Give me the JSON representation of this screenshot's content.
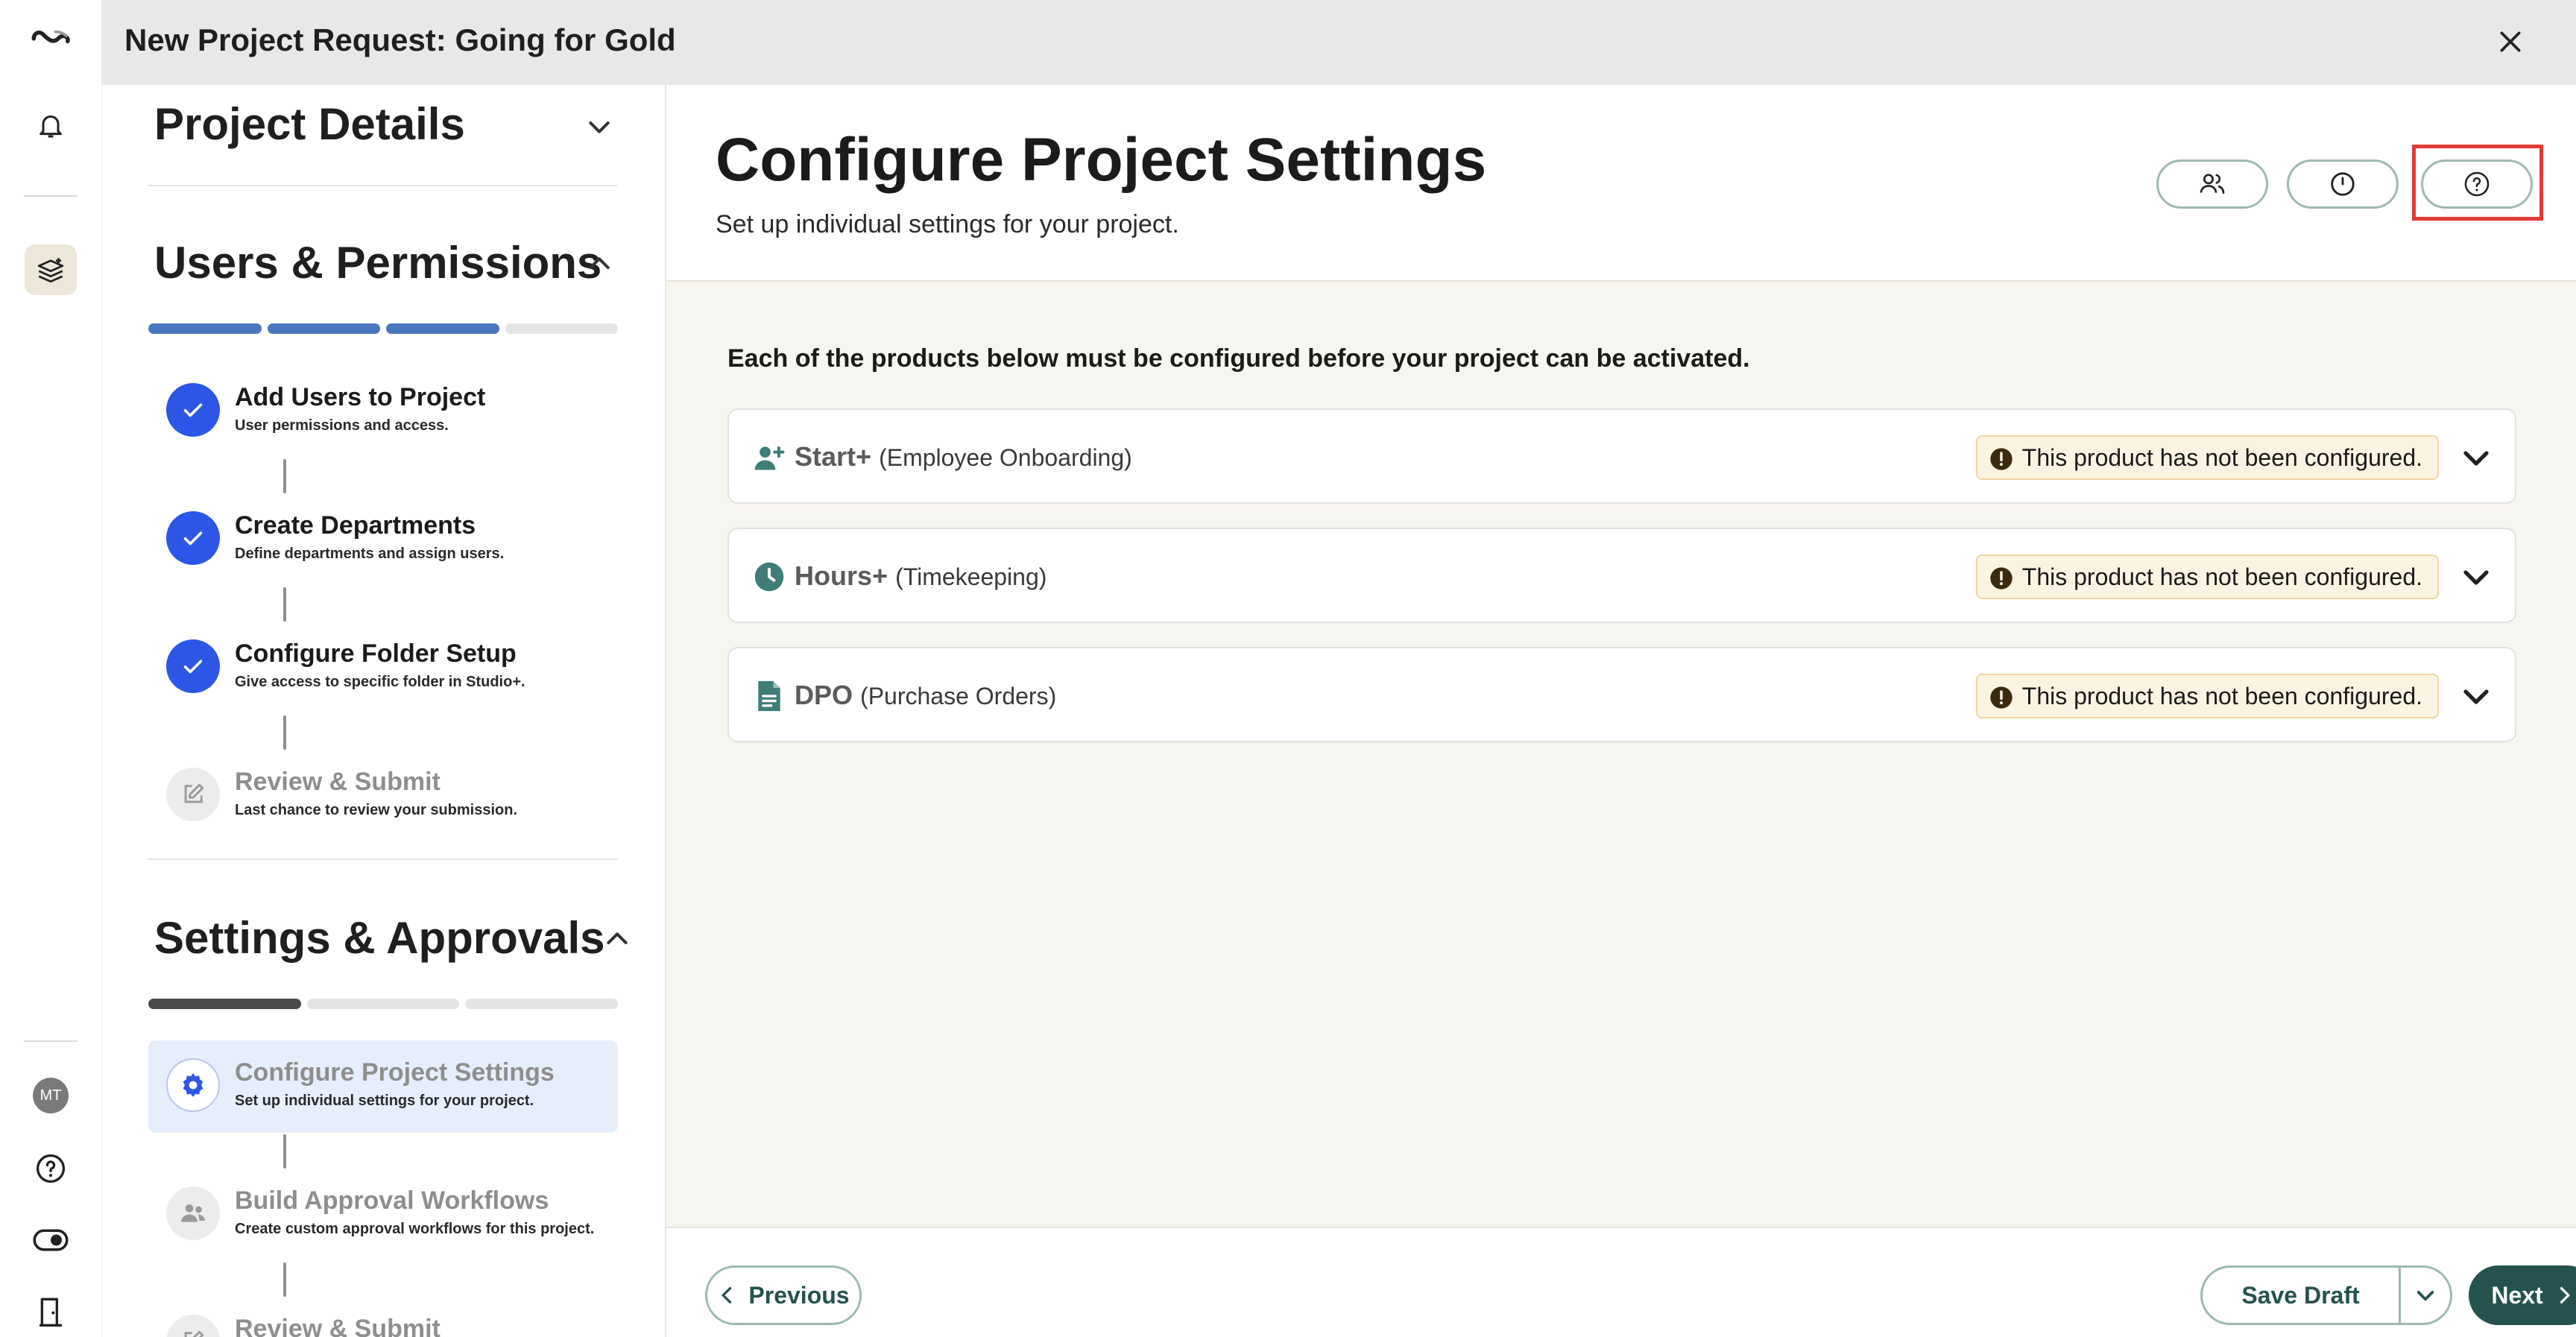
{
  "app": {
    "window_title": "New Project Request: Going for Gold"
  },
  "rail": {
    "avatar_initials": "MT"
  },
  "sections": [
    {
      "title": "Project Details",
      "expanded": false
    },
    {
      "title": "Users & Permissions",
      "expanded": true,
      "progress": [
        1,
        1,
        1,
        0
      ],
      "steps": [
        {
          "name": "Add Users to Project",
          "desc": "User permissions and access.",
          "status": "done"
        },
        {
          "name": "Create Departments",
          "desc": "Define departments and assign users.",
          "status": "done"
        },
        {
          "name": "Configure Folder Setup",
          "desc": "Give access to specific folder in Studio+.",
          "status": "done"
        },
        {
          "name": "Review & Submit",
          "desc": "Last chance to review your submission.",
          "status": "pending"
        }
      ]
    },
    {
      "title": "Settings & Approvals",
      "expanded": true,
      "progress": [
        1,
        0,
        0
      ],
      "steps": [
        {
          "name": "Configure Project Settings",
          "desc": "Set up individual settings for your project.",
          "status": "active"
        },
        {
          "name": "Build Approval Workflows",
          "desc": "Create custom approval workflows for this project.",
          "status": "pending"
        },
        {
          "name": "Review & Submit",
          "desc": "",
          "status": "pending"
        }
      ]
    }
  ],
  "main": {
    "title": "Configure Project Settings",
    "subtitle": "Set up individual settings for your project.",
    "notice": "Each of the products below must be configured before your project can be activated.",
    "products": [
      {
        "name": "Start+",
        "detail": "(Employee Onboarding)",
        "icon": "user-add-icon",
        "status": "This product has not been configured."
      },
      {
        "name": "Hours+",
        "detail": "(Timekeeping)",
        "icon": "clock-icon",
        "status": "This product has not been configured."
      },
      {
        "name": "DPO",
        "detail": "(Purchase Orders)",
        "icon": "document-icon",
        "status": "This product has not been configured."
      }
    ]
  },
  "footer": {
    "previous_label": "Previous",
    "save_draft_label": "Save Draft",
    "next_label": "Next"
  },
  "colors": {
    "accent_teal": "#25524e",
    "step_done_blue": "#2e56e6",
    "progress_blue": "#4a76c0",
    "progress_dark": "#4a4a4a",
    "warning_bg": "#fbf3e2",
    "highlight_red": "#e53935"
  }
}
